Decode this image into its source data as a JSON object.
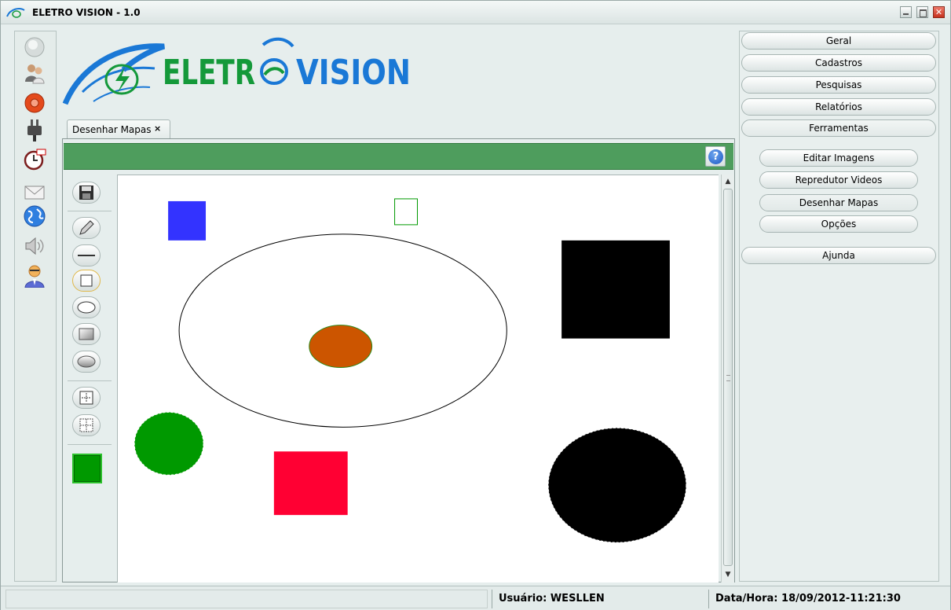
{
  "window": {
    "title": "ELETRO VISION - 1.0",
    "app_icon": "eye-logo-icon",
    "controls": [
      "minimize-icon",
      "maximize-icon",
      "close-icon"
    ]
  },
  "logo": {
    "text_green": "ELETR",
    "text_blue": "VISION",
    "colors": {
      "green": "#14993a",
      "blue": "#1a78d6"
    }
  },
  "left_toolbar": {
    "icons": [
      "status-circle-icon",
      "users-icon",
      "record-icon",
      "plug-icon",
      "alarm-clock-icon",
      "mail-icon",
      "globe-icon",
      "speaker-icon",
      "user-tie-icon"
    ]
  },
  "tabs": [
    {
      "label": "Desenhar Mapas",
      "close": "×",
      "active": true
    }
  ],
  "header_bar": {
    "color": "#4e9d5d",
    "help_label": "?"
  },
  "drawing_tools": {
    "items": [
      "save-icon",
      "pencil-icon",
      "line-icon",
      "rectangle-outline-icon",
      "ellipse-outline-icon",
      "rectangle-filled-icon",
      "ellipse-filled-icon",
      "grid-snap-icon",
      "grid-dotted-icon"
    ],
    "selected": "rectangle-outline-icon",
    "current_color": "#009900"
  },
  "canvas": {
    "background": "#ffffff",
    "shape_colors": [
      "#3333ff",
      "#009900",
      "#000000",
      "#cc5500",
      "#009900",
      "#ff0033",
      "#000000"
    ]
  },
  "menu": {
    "items": [
      {
        "label": "Geral"
      },
      {
        "label": "Cadastros"
      },
      {
        "label": "Pesquisas"
      },
      {
        "label": "Relatórios"
      },
      {
        "label": "Ferramentas",
        "open": true
      }
    ],
    "submenu": [
      {
        "label": "Editar Imagens"
      },
      {
        "label": "Repredutor Videos"
      },
      {
        "label": "Desenhar Mapas",
        "selected": true
      },
      {
        "label": "Opções"
      }
    ],
    "help": {
      "label": "Ajunda"
    }
  },
  "status": {
    "user": "Usuário: WESLLEN",
    "datetime": "Data/Hora: 18/09/2012-11:21:30"
  }
}
